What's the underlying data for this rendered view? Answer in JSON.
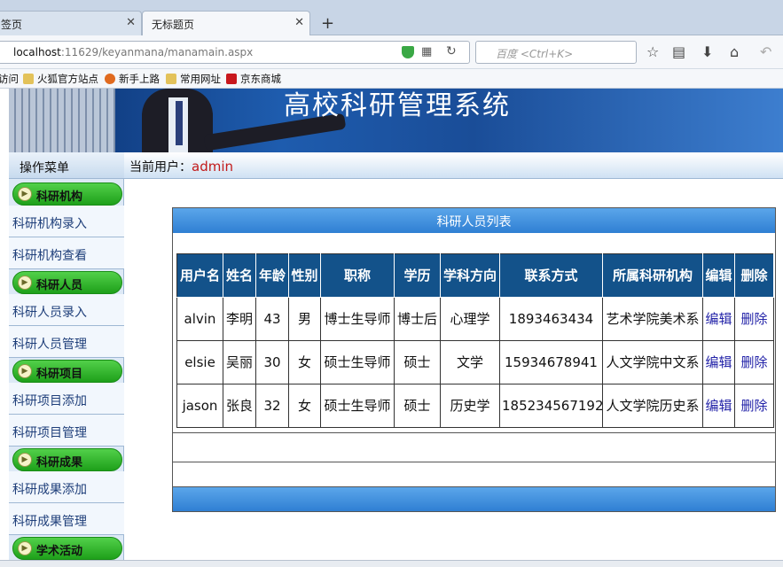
{
  "browser": {
    "tabs": [
      {
        "label": "签页",
        "active": false
      },
      {
        "label": "无标题页",
        "active": true
      }
    ],
    "url_host": "localhost",
    "url_path": ":11629/keyanmana/manamain.aspx",
    "search_placeholder": "百度 <Ctrl+K>",
    "bookmarks": [
      "访问",
      "火狐官方站点",
      "新手上路",
      "常用网址",
      "京东商城"
    ]
  },
  "banner": {
    "title": "高校科研管理系统"
  },
  "menu": {
    "header": "操作菜单",
    "groups": [
      {
        "label": "科研机构",
        "items": [
          "科研机构录入",
          "科研机构查看"
        ]
      },
      {
        "label": "科研人员",
        "items": [
          "科研人员录入",
          "科研人员管理"
        ]
      },
      {
        "label": "科研项目",
        "items": [
          "科研项目添加",
          "科研项目管理"
        ]
      },
      {
        "label": "科研成果",
        "items": [
          "科研成果添加",
          "科研成果管理"
        ]
      },
      {
        "label": "学术活动",
        "items": []
      }
    ]
  },
  "userbar": {
    "label": "当前用户：",
    "username": "admin"
  },
  "panel": {
    "title": "科研人员列表",
    "columns": [
      "用户名",
      "姓名",
      "年龄",
      "性别",
      "职称",
      "学历",
      "学科方向",
      "联系方式",
      "所属科研机构",
      "编辑",
      "删除"
    ],
    "rows": [
      [
        "alvin",
        "李明",
        "43",
        "男",
        "博士生导师",
        "博士后",
        "心理学",
        "1893463434",
        "艺术学院美术系",
        "编辑",
        "删除"
      ],
      [
        "elsie",
        "吴丽",
        "30",
        "女",
        "硕士生导师",
        "硕士",
        "文学",
        "15934678941",
        "人文学院中文系",
        "编辑",
        "删除"
      ],
      [
        "jason",
        "张良",
        "32",
        "女",
        "硕士生导师",
        "硕士",
        "历史学",
        "185234567192",
        "人文学院历史系",
        "编辑",
        "删除"
      ]
    ]
  }
}
